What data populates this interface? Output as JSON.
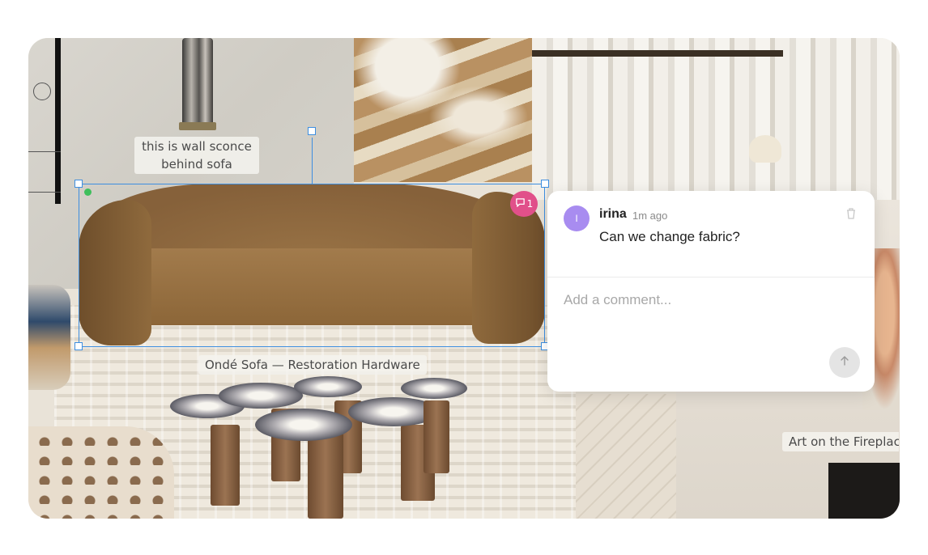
{
  "board": {
    "captions": {
      "sconce_line1": "this is wall sconce",
      "sconce_line2": "behind sofa",
      "sofa": "Ondé Sofa — Restoration Hardware",
      "art": "Art on the Fireplac"
    },
    "comment_badge": {
      "count": "1",
      "icon": "comment-icon"
    }
  },
  "comment": {
    "avatar_initial": "I",
    "author": "irina",
    "time": "1m ago",
    "message": "Can we change fabric?",
    "delete_icon": "trash-icon",
    "input_placeholder": "Add a comment...",
    "send_icon": "arrow-up-icon"
  },
  "colors": {
    "selection": "#3d8ee0",
    "badge": "#e1508a",
    "avatar": "#a88cf0",
    "status_dot": "#3fbf5c"
  }
}
